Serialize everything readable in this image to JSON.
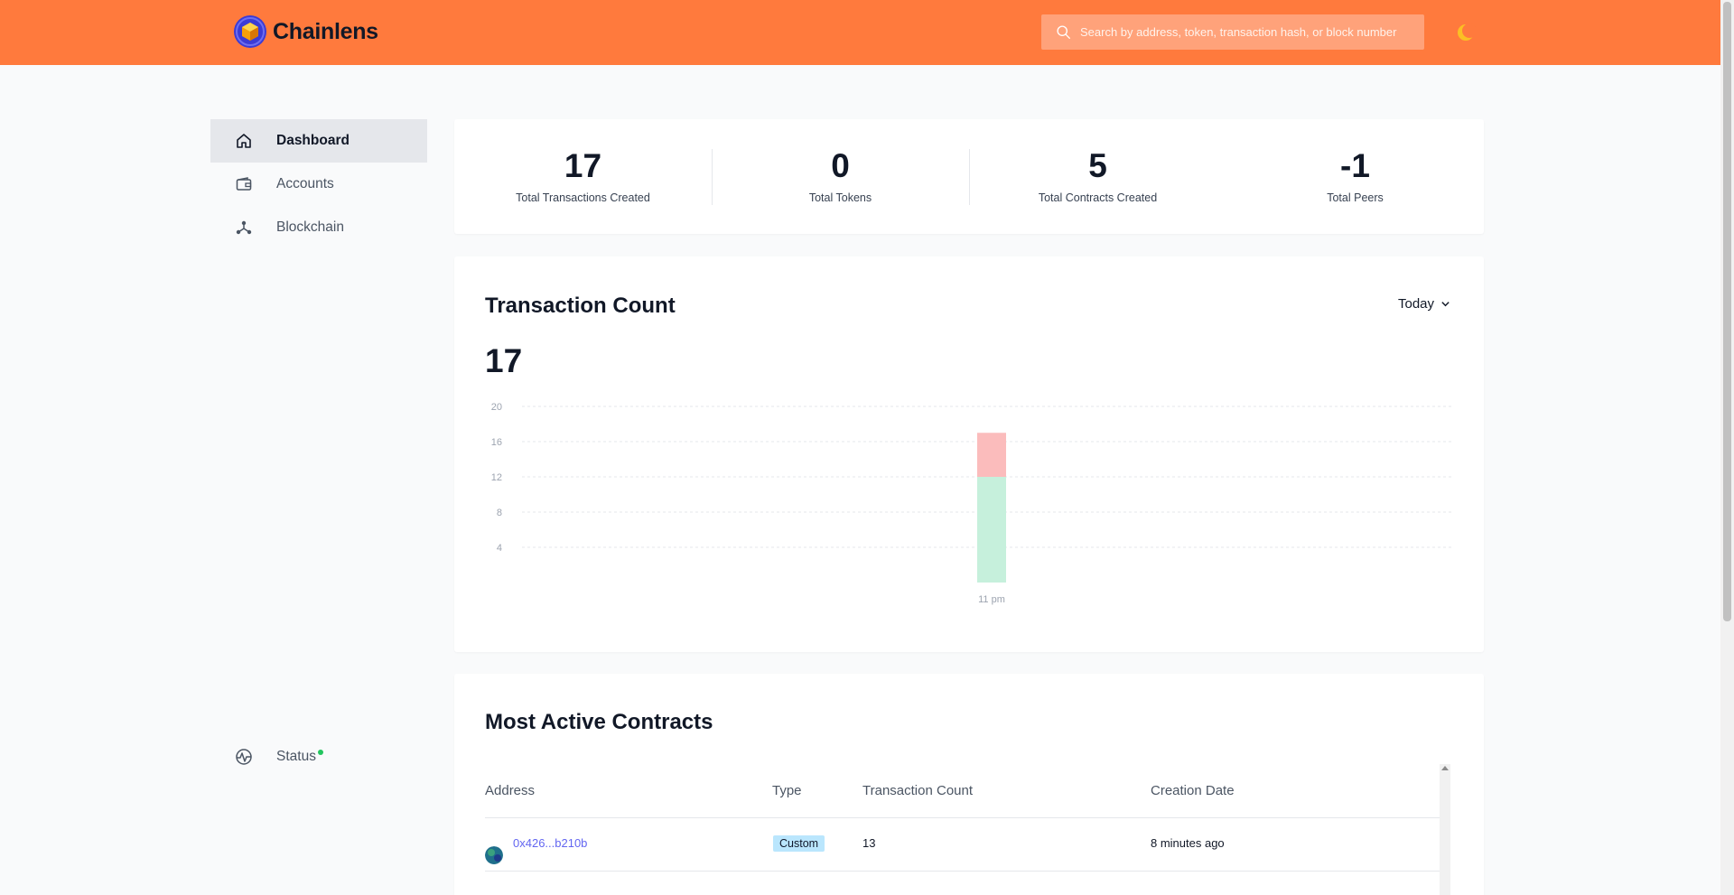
{
  "header": {
    "brand_name": "Chainlens",
    "search_placeholder": "Search by address, token, transaction hash, or block number"
  },
  "sidebar": {
    "items": [
      {
        "label": "Dashboard",
        "icon": "home-icon",
        "active": true
      },
      {
        "label": "Accounts",
        "icon": "wallet-icon",
        "active": false
      },
      {
        "label": "Blockchain",
        "icon": "network-icon",
        "active": false
      }
    ],
    "status": {
      "label": "Status",
      "icon": "activity-icon",
      "indicator_color": "#22c55e"
    }
  },
  "stats": [
    {
      "value": "17",
      "label": "Total Transactions Created"
    },
    {
      "value": "0",
      "label": "Total Tokens"
    },
    {
      "value": "5",
      "label": "Total Contracts Created"
    },
    {
      "value": "-1",
      "label": "Total Peers"
    }
  ],
  "transaction_chart": {
    "title": "Transaction Count",
    "period": "Today",
    "total": "17"
  },
  "chart_data": {
    "type": "bar",
    "stacked": true,
    "categories": [
      "11 pm"
    ],
    "series": [
      {
        "values": [
          12
        ],
        "color": "#c6f0dc"
      },
      {
        "values": [
          5
        ],
        "color": "#fbbcbc"
      }
    ],
    "y_ticks": [
      4,
      8,
      12,
      16,
      20
    ],
    "ylim": [
      0,
      20
    ],
    "grid": true
  },
  "contracts": {
    "title": "Most Active Contracts",
    "columns": [
      "Address",
      "Type",
      "Transaction Count",
      "Creation Date"
    ],
    "rows": [
      {
        "address": "0x426...b210b",
        "type": "Custom",
        "tx_count": "13",
        "created": "8 minutes ago"
      }
    ]
  },
  "colors": {
    "header_bg": "#ff7a3d",
    "accent_link": "#6366f1",
    "badge_bg": "#bae6fd"
  }
}
